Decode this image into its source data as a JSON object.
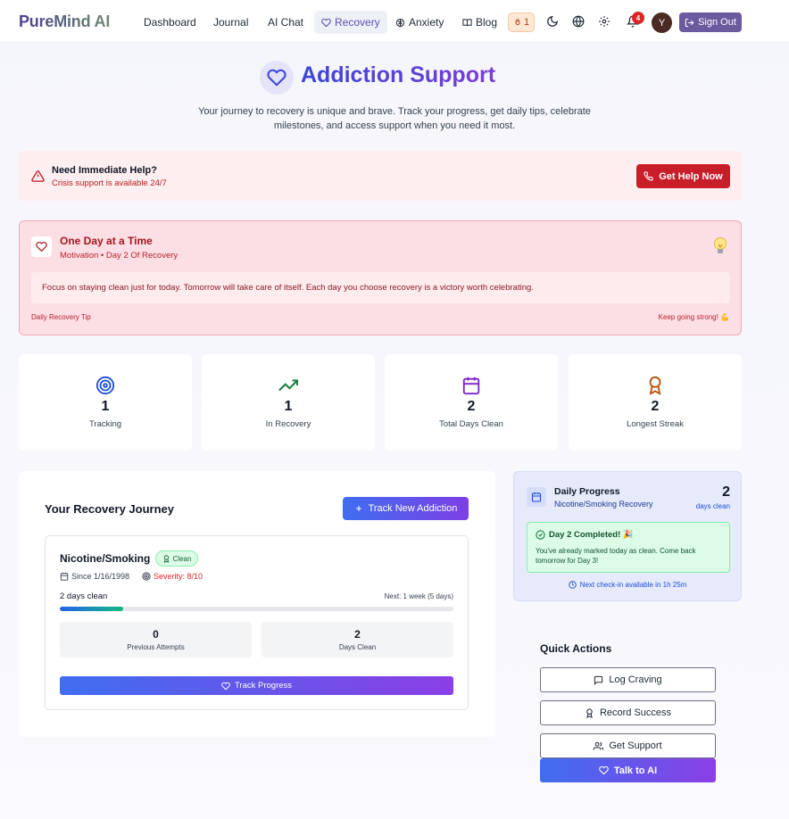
{
  "nav": {
    "brand": "PureMind AI",
    "items": [
      {
        "label": "Dashboard"
      },
      {
        "label": "Journal"
      },
      {
        "label": "AI Chat"
      },
      {
        "label": "Recovery"
      },
      {
        "label": "Anxiety"
      },
      {
        "label": "Blog"
      }
    ],
    "streak_count": "1",
    "notification_count": "4",
    "avatar_initial": "Y",
    "sign_out_label": "Sign Out",
    "active_item": "Recovery"
  },
  "hero": {
    "title": "Addiction Support",
    "subtitle": "Your journey to recovery is unique and brave. Track your progress, get daily tips, celebrate milestones, and access support when you need it most."
  },
  "help_banner": {
    "title": "Need Immediate Help?",
    "subtitle": "Crisis support is available 24/7",
    "button_label": "Get Help Now"
  },
  "motivation": {
    "title": "One Day at a Time",
    "subtitle": "Motivation • Day 2 Of Recovery",
    "message": "Focus on staying clean just for today. Tomorrow will take care of itself. Each day you choose recovery is a victory worth celebrating.",
    "footer_left": "Daily Recovery Tip",
    "footer_right": "Keep going strong! 💪"
  },
  "stats": [
    {
      "icon": "target-icon",
      "value": "1",
      "label": "Tracking"
    },
    {
      "icon": "trending-up-icon",
      "value": "1",
      "label": "In Recovery"
    },
    {
      "icon": "calendar-icon",
      "value": "2",
      "label": "Total Days Clean"
    },
    {
      "icon": "award-icon",
      "value": "2",
      "label": "Longest Streak"
    }
  ],
  "journey": {
    "title": "Your Recovery Journey",
    "add_button_label": "Track New Addiction",
    "card": {
      "name": "Nicotine/Smoking",
      "badge": "Clean",
      "since": "Since 1/16/1998",
      "severity": "Severity: 8/10",
      "days_clean_text": "2 days clean",
      "next_milestone": "Next: 1 week (5 days)",
      "progress_fraction": 0.16,
      "previous_attempts_value": "0",
      "previous_attempts_label": "Previous Attempts",
      "days_clean_value": "2",
      "days_clean_label": "Days Clean",
      "track_button_label": "Track Progress"
    }
  },
  "daily_progress": {
    "title": "Daily Progress",
    "subtitle": "Nicotine/Smoking Recovery",
    "count": "2",
    "count_unit": "days clean",
    "completed_title": "Day 2 Completed! 🎉",
    "completed_message": "You've already marked today as clean. Come back tomorrow for Day 3!",
    "next_checkin": "Next check-in available in 1h 25m"
  },
  "quick_actions": {
    "title": "Quick Actions",
    "log_craving": "Log Craving",
    "record_success": "Record Success",
    "get_support": "Get Support",
    "talk_to_ai": "Talk to AI"
  },
  "colors": {
    "accent_purple": "#6b5a9e",
    "danger": "#c81e2a",
    "gradient_start": "#3f6ef0",
    "gradient_end": "#8b3fe6"
  }
}
